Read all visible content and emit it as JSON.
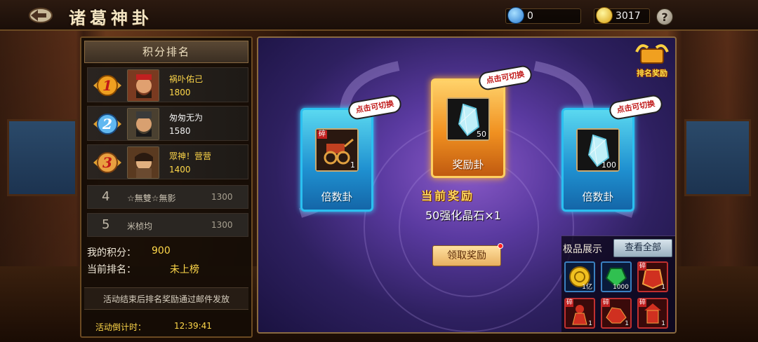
{
  "header": {
    "title": "诸葛神卦",
    "currency1_value": "0",
    "currency2_value": "3017",
    "help_label": "?"
  },
  "ranking": {
    "title": "积分排名",
    "entries": [
      {
        "rank": "1",
        "name": "祸卟佑己",
        "score": "1800",
        "name_color": "#ffd84a"
      },
      {
        "rank": "2",
        "name": "匆匆无为",
        "score": "1580",
        "name_color": "#f0f0f0"
      },
      {
        "rank": "3",
        "name": "眾神！营营",
        "score": "1400",
        "name_color": "#ffd84a"
      },
      {
        "rank": "4",
        "name": "☆無雙☆無影",
        "score": "1300"
      },
      {
        "rank": "5",
        "name": "米桢均",
        "score": "1300"
      }
    ],
    "my_score_label": "我的积分：",
    "my_score_value": "900",
    "my_rank_label": "当前排名：",
    "my_rank_value": "未上榜",
    "notice": "活动结束后排名奖励通过邮件发放",
    "countdown_label": "活动倒计时：",
    "countdown_value": "12:39:41"
  },
  "main": {
    "rank_reward_label": "排名奖励",
    "bubble_text": "点击可切换",
    "cards": [
      {
        "id": "left",
        "label": "倍数卦",
        "count": "1",
        "shard": "碎",
        "icon": "chariot-icon"
      },
      {
        "id": "center",
        "label": "奖励卦",
        "count": "50",
        "icon": "crystal-icon"
      },
      {
        "id": "right",
        "label": "倍数卦",
        "count": "100",
        "icon": "crystal-icon"
      }
    ],
    "current_reward_title": "当前奖励",
    "current_reward_text": "50强化晶石×1",
    "claim_label": "领取奖励"
  },
  "showcase": {
    "title": "极品展示",
    "view_all_label": "查看全部",
    "items": [
      {
        "icon": "gold-coin-icon",
        "count": "1亿",
        "shard": ""
      },
      {
        "icon": "green-gem-icon",
        "count": "1000",
        "shard": ""
      },
      {
        "icon": "red-armor-icon",
        "count": "1",
        "shard": "碎"
      },
      {
        "icon": "red-warrior-icon",
        "count": "1",
        "shard": "碎"
      },
      {
        "icon": "red-beast-icon",
        "count": "1",
        "shard": "碎"
      },
      {
        "icon": "red-tower-icon",
        "count": "1",
        "shard": "碎"
      }
    ]
  },
  "colors": {
    "gold_text": "#ffd84a",
    "accent_blue": "#2ac0f0",
    "accent_orange": "#f09020"
  }
}
